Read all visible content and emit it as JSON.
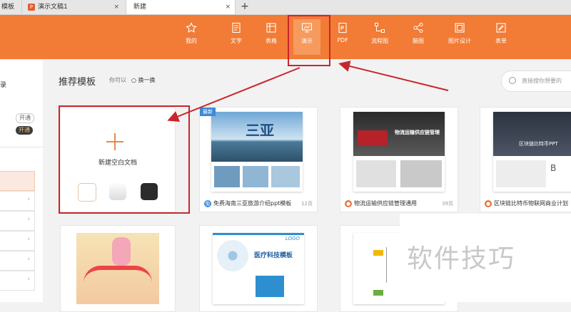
{
  "tabs": [
    {
      "label": "模板"
    },
    {
      "label": "演示文稿1"
    },
    {
      "label": "新建"
    }
  ],
  "new_tab_symbol": "+",
  "tab_close_symbol": "×",
  "ribbon": {
    "bg_color": "#f27b35",
    "tools": [
      {
        "label": "我的",
        "icon": "star-icon"
      },
      {
        "label": "文字",
        "icon": "writer-doc-icon"
      },
      {
        "label": "表格",
        "icon": "spreadsheet-icon"
      },
      {
        "label": "演示",
        "icon": "presentation-icon",
        "active": true
      },
      {
        "label": "PDF",
        "icon": "pdf-icon"
      },
      {
        "label": "流程图",
        "icon": "flowchart-icon"
      },
      {
        "label": "脑图",
        "icon": "mindmap-icon"
      },
      {
        "label": "图片设计",
        "icon": "image-design-icon"
      },
      {
        "label": "表单",
        "icon": "form-icon"
      }
    ]
  },
  "sidebar": {
    "partial_label": "录",
    "badge1": "开通",
    "badge2": "开通"
  },
  "main": {
    "title": "推荐模板",
    "like_text": "你可以",
    "refresh_text": "换一换",
    "search_placeholder": "直接搜你想要的"
  },
  "new_doc": {
    "label": "新建空白文档",
    "swatches": [
      "#ffffff",
      "#e8e8e8",
      "#2b2b2b"
    ]
  },
  "templates": [
    {
      "badge": "最新",
      "title": "免费海南三亚旅游介绍ppt模板",
      "pages": "12页",
      "icon": "免",
      "icon_color": "#3d88d9",
      "thumb_title": "三亚"
    },
    {
      "title": "物流运输供应链管理通用",
      "pages": "39页",
      "icon": "●",
      "icon_color": "#e8743c",
      "thumb_title": "物流运输供应链管理"
    },
    {
      "title": "区块链比特币物联网商业计划",
      "pages": "",
      "icon": "●",
      "icon_color": "#e8743c",
      "thumb_title": "区块链比特币PPT"
    },
    {
      "title": "",
      "pages": "",
      "thumb_title": ""
    },
    {
      "title": "",
      "pages": "",
      "thumb_title": "医疗科技模板",
      "thumb_logo": "LOGO"
    },
    {
      "title": "",
      "pages": "",
      "thumb_title": ""
    }
  ],
  "watermark": "软件技巧",
  "annotation_color": "#c9262c"
}
